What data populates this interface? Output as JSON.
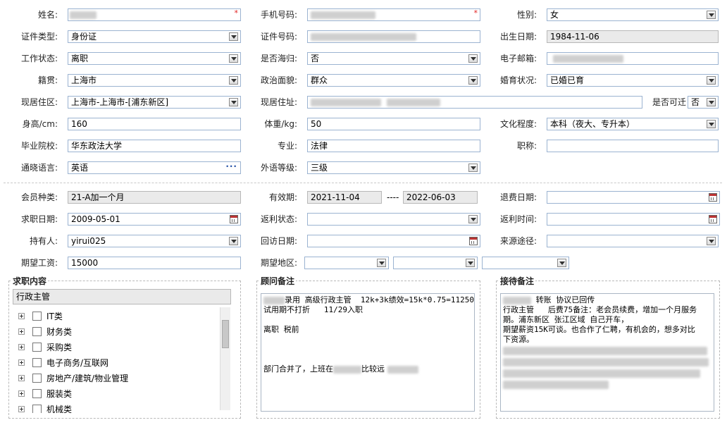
{
  "personal": {
    "name_label": "姓名:",
    "mobile_label": "手机号码:",
    "gender_label": "性别:",
    "gender_value": "女",
    "idtype_label": "证件类型:",
    "idtype_value": "身份证",
    "idno_label": "证件号码:",
    "birth_label": "出生日期:",
    "birth_value": "1984-11-06",
    "workstatus_label": "工作状态:",
    "workstatus_value": "离职",
    "overseas_label": "是否海归:",
    "overseas_value": "否",
    "email_label": "电子邮箱:",
    "native_label": "籍贯:",
    "native_value": "上海市",
    "political_label": "政治面貌:",
    "political_value": "群众",
    "marital_label": "婚育状况:",
    "marital_value": "已婚已育",
    "residence_label": "现居住区:",
    "residence_value": "上海市-上海市-[浦东新区]",
    "address_label": "现居住址:",
    "relocate_label": "是否可迁",
    "relocate_value": "否",
    "height_label": "身高/cm:",
    "height_value": "160",
    "weight_label": "体重/kg:",
    "weight_value": "50",
    "education_label": "文化程度:",
    "education_value": "本科（夜大、专升本）",
    "school_label": "毕业院校:",
    "school_value": "华东政法大学",
    "major_label": "专业:",
    "major_value": "法律",
    "title_label": "职称:",
    "language_label": "通晓语言:",
    "language_value": "英语",
    "langlevel_label": "外语等级:",
    "langlevel_value": "三级",
    "required_mark": "*"
  },
  "membership": {
    "type_label": "会员种类:",
    "type_value": "21-A加一个月",
    "valid_label": "有效期:",
    "valid_from": "2021-11-04",
    "valid_sep": "----",
    "valid_to": "2022-06-03",
    "refund_label": "退费日期:",
    "jobdate_label": "求职日期:",
    "jobdate_value": "2009-05-01",
    "rebate_status_label": "返利状态:",
    "rebate_time_label": "返利时间:",
    "holder_label": "持有人:",
    "holder_value": "yirui025",
    "visit_label": "回访日期:",
    "source_label": "来源途径:",
    "salary_label": "期望工资:",
    "salary_value": "15000",
    "region_label": "期望地区:"
  },
  "job_content": {
    "title": "求职内容",
    "selected": "行政主管",
    "tree": [
      "IT类",
      "财务类",
      "采购类",
      "电子商务/互联网",
      "房地产/建筑/物业管理",
      "服装类",
      "机械类"
    ]
  },
  "consultant_notes": {
    "title": "顾问备注",
    "line1_suffix": "录用 高级行政主管  12k+3k绩效=15k*0.75=11250",
    "line2": "试用期不打折   11/29入职",
    "line3": "离职 税前",
    "line4_prefix": "部门合并了，上班在",
    "line4_mid": "比较远"
  },
  "reception_notes": {
    "title": "接待备注",
    "line1_suffix": " 转账 协议已回传",
    "line2": "行政主管   后费75备注：老会员续费，增加一个月服务",
    "line3": "期。浦东新区 张江区域 自己开车，",
    "line4": "期望薪资15K可谈。也合作了仁聘，有机会的，想多对比",
    "line5": "下资源。"
  },
  "icons": {
    "select": "chevron-down-icon",
    "calendar": "calendar-icon",
    "more": "ellipsis-icon",
    "expand": "plus-box-icon"
  }
}
